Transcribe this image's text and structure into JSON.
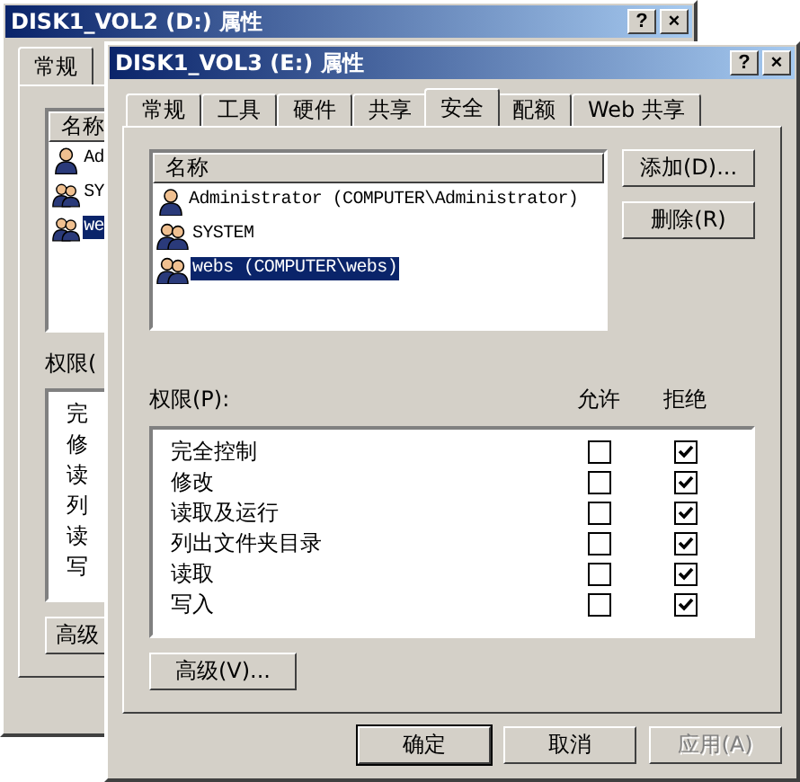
{
  "back_window": {
    "title": "DISK1_VOL2 (D:) 属性",
    "title_buttons": [
      "?",
      "×"
    ],
    "tabs": [
      {
        "label": "常规",
        "selected": true
      }
    ],
    "names_header": "名称",
    "users": [
      {
        "name": "Ad",
        "kind": "user",
        "selected": false
      },
      {
        "name": "SY",
        "kind": "group",
        "selected": false
      },
      {
        "name": "we",
        "kind": "group",
        "selected": true
      }
    ],
    "permissions_label": "权限(",
    "permissions": [
      "完",
      "修",
      "读",
      "列",
      "读",
      "写"
    ],
    "advanced_button": "高级"
  },
  "front_window": {
    "title": "DISK1_VOL3 (E:) 属性",
    "title_buttons": [
      "?",
      "×"
    ],
    "tabs": [
      {
        "label": "常规",
        "selected": false
      },
      {
        "label": "工具",
        "selected": false
      },
      {
        "label": "硬件",
        "selected": false
      },
      {
        "label": "共享",
        "selected": false
      },
      {
        "label": "安全",
        "selected": true
      },
      {
        "label": "配额",
        "selected": false
      },
      {
        "label": "Web 共享",
        "selected": false
      }
    ],
    "names_header": "名称",
    "users": [
      {
        "name": "Administrator (COMPUTER\\Administrator)",
        "kind": "user",
        "selected": false
      },
      {
        "name": "SYSTEM",
        "kind": "group",
        "selected": false
      },
      {
        "name": "webs (COMPUTER\\webs)",
        "kind": "group",
        "selected": true
      }
    ],
    "user_buttons": [
      "添加(D)...",
      "删除(R)"
    ],
    "permissions_label": "权限(P):",
    "allow_header": "允许",
    "deny_header": "拒绝",
    "permissions": [
      {
        "name": "完全控制",
        "allow": false,
        "deny": true
      },
      {
        "name": "修改",
        "allow": false,
        "deny": true
      },
      {
        "name": "读取及运行",
        "allow": false,
        "deny": true
      },
      {
        "name": "列出文件夹目录",
        "allow": false,
        "deny": true
      },
      {
        "name": "读取",
        "allow": false,
        "deny": true
      },
      {
        "name": "写入",
        "allow": false,
        "deny": true
      }
    ],
    "advanced_button": "高级(V)...",
    "footer_buttons": [
      {
        "label": "确定",
        "disabled": false,
        "default": true
      },
      {
        "label": "取消",
        "disabled": false,
        "default": false
      },
      {
        "label": "应用(A)",
        "disabled": true,
        "default": false
      }
    ]
  }
}
